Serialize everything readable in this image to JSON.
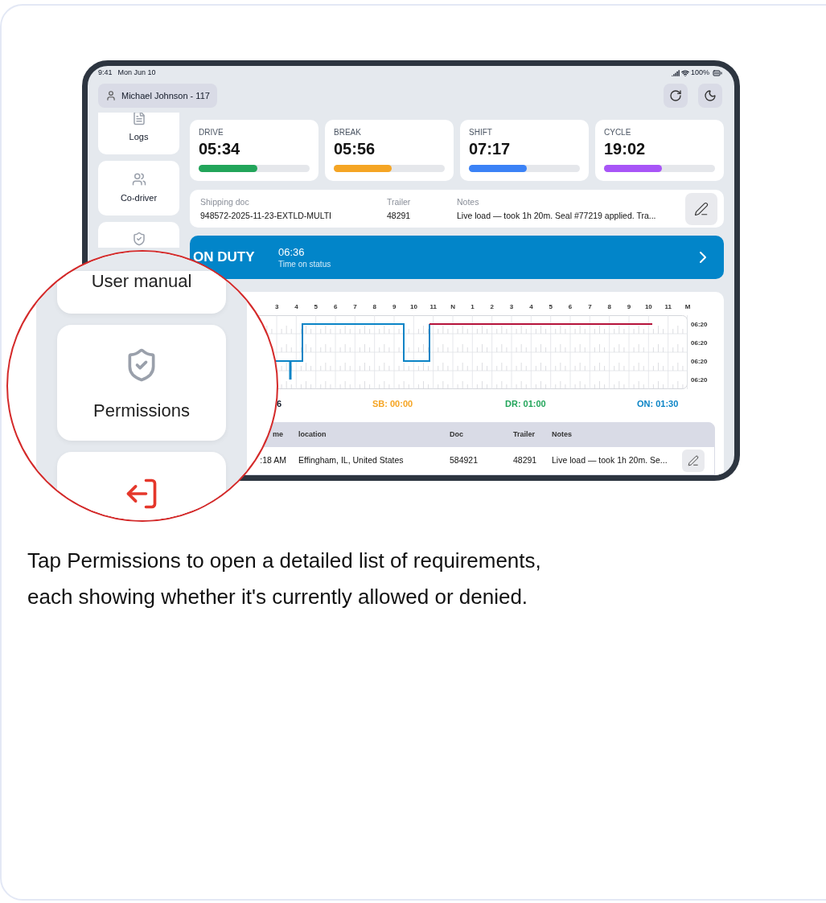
{
  "status_bar": {
    "time": "9:41",
    "date": "Mon Jun 10",
    "battery": "100%"
  },
  "user": {
    "label": "Michael Johnson - 117"
  },
  "sidebar": {
    "items": [
      {
        "kind": "logs",
        "label": "Logs"
      },
      {
        "kind": "co-driver",
        "label": "Co-driver"
      },
      {
        "kind": "permissions"
      }
    ]
  },
  "stats": [
    {
      "label": "DRIVE",
      "value": "05:34",
      "level": 0.53,
      "color": "#22a55a"
    },
    {
      "label": "BREAK",
      "value": "05:56",
      "level": 0.52,
      "color": "#f5a524"
    },
    {
      "label": "SHIFT",
      "value": "07:17",
      "level": 0.52,
      "color": "#3b82f6"
    },
    {
      "label": "CYCLE",
      "value": "19:02",
      "level": 0.52,
      "color": "#a855f7"
    }
  ],
  "shipping": {
    "fields": [
      {
        "label": "Shipping doc",
        "value": "948572-2025-11-23-EXTLD-MULTI"
      },
      {
        "label": "Trailer",
        "value": "48291"
      },
      {
        "label": "Notes",
        "value": "Live load — took 1h 20m. Seal #77219 applied. Tra..."
      }
    ]
  },
  "duty": {
    "status": "ON DUTY",
    "time": "06:36",
    "caption": "Time on status"
  },
  "log_graph": {
    "hour_labels": [
      "3",
      "4",
      "5",
      "6",
      "7",
      "8",
      "9",
      "10",
      "11",
      "N",
      "1",
      "2",
      "3",
      "4",
      "5",
      "6",
      "7",
      "8",
      "9",
      "10",
      "11",
      "M"
    ],
    "row_labels": [
      "06:20",
      "06:20",
      "06:20",
      "06:20"
    ],
    "totals": [
      {
        "text": "6",
        "color": "#111827"
      },
      {
        "text": "SB: 00:00",
        "color": "#f5a524"
      },
      {
        "text": "DR: 01:00",
        "color": "#22a55a"
      },
      {
        "text": "ON: 01:30",
        "color": "#0a84c6"
      }
    ]
  },
  "table": {
    "columns": [
      "me",
      "location",
      "Doc",
      "Trailer",
      "Notes"
    ],
    "rows": [
      {
        "cells": [
          ":18 AM",
          "Effingham, IL, United States",
          "584921",
          "48291",
          "Live load — took 1h 20m. Se..."
        ]
      }
    ]
  },
  "magnifier": {
    "items": [
      {
        "kind": "manual",
        "label": "User manual"
      },
      {
        "kind": "permissions",
        "label": "Permissions"
      },
      {
        "kind": "logout"
      }
    ]
  },
  "caption": "Tap Permissions to open a detailed list of requirements, each showing whether it's currently allowed or denied."
}
